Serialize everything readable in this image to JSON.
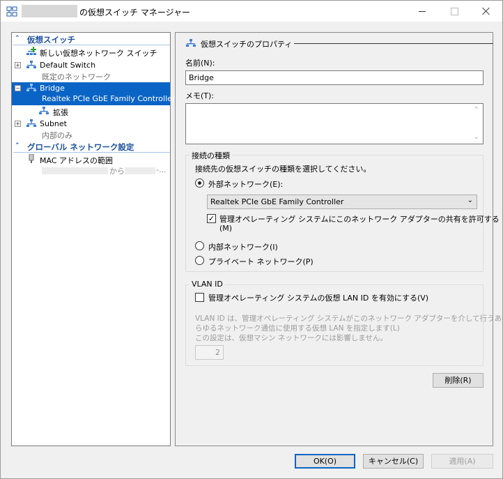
{
  "window": {
    "title": "の仮想スイッチ マネージャー",
    "minimize_icon": "minimize-icon",
    "maximize_icon": "maximize-icon",
    "close_icon": "close-icon"
  },
  "sidebar": {
    "section_virtual_switches": "仮想スイッチ",
    "new_switch_label": "新しい仮想ネットワーク スイッチ",
    "switches": [
      {
        "name": "Default Switch",
        "detail": "既定のネットワーク",
        "expander": "+"
      },
      {
        "name": "Bridge",
        "detail": "Realtek PCIe GbE Family Controller",
        "expander": "−",
        "selected": true
      },
      {
        "name": "Subnet",
        "detail": "内部のみ",
        "expander": "+"
      }
    ],
    "extension_label": "拡張",
    "section_global": "グローバル ネットワーク設定",
    "mac_label": "MAC アドレスの範囲",
    "mac_from": "から",
    "mac_ellipsis": "-..."
  },
  "properties": {
    "header": "仮想スイッチのプロパティ",
    "name_label": "名前(N):",
    "name_value": "Bridge",
    "memo_label": "メモ(T):",
    "memo_value": "",
    "conn_type_title": "接続の種類",
    "conn_type_desc": "接続先の仮想スイッチの種類を選択してください。",
    "external_label": "外部ネットワーク(E):",
    "adapter_selected": "Realtek PCIe GbE Family Controller",
    "allow_share_line1": "管理オペレーティング システムにこのネットワーク アダプターの共有を許可する",
    "allow_share_line2": "(M)",
    "internal_label": "内部ネットワーク(I)",
    "private_label": "プライベート ネットワーク(P)",
    "vlan_title": "VLAN ID",
    "vlan_enable_label": "管理オペレーティング システムの仮想 LAN ID を有効にする(V)",
    "vlan_desc_line1": "VLAN ID は、管理オペレーティング システムがこのネットワーク アダプターを介して行うあ",
    "vlan_desc_line2": "らゆるネットワーク通信に使用する仮想 LAN を指定します(L)",
    "vlan_desc_line3": "この設定は、仮想マシン ネットワークには影響しません。",
    "vlan_value": "2",
    "delete_label": "削除(R)"
  },
  "footer": {
    "ok_label": "OK(O)",
    "cancel_label": "キャンセル(C)",
    "apply_label": "適用(A)"
  },
  "state": {
    "connection_type": "external",
    "allow_share_checked": true,
    "vlan_enabled": false
  },
  "colors": {
    "accent": "#0a64c6",
    "section_header": "#1b4f9c",
    "panel_bg": "#f0f0f0"
  }
}
